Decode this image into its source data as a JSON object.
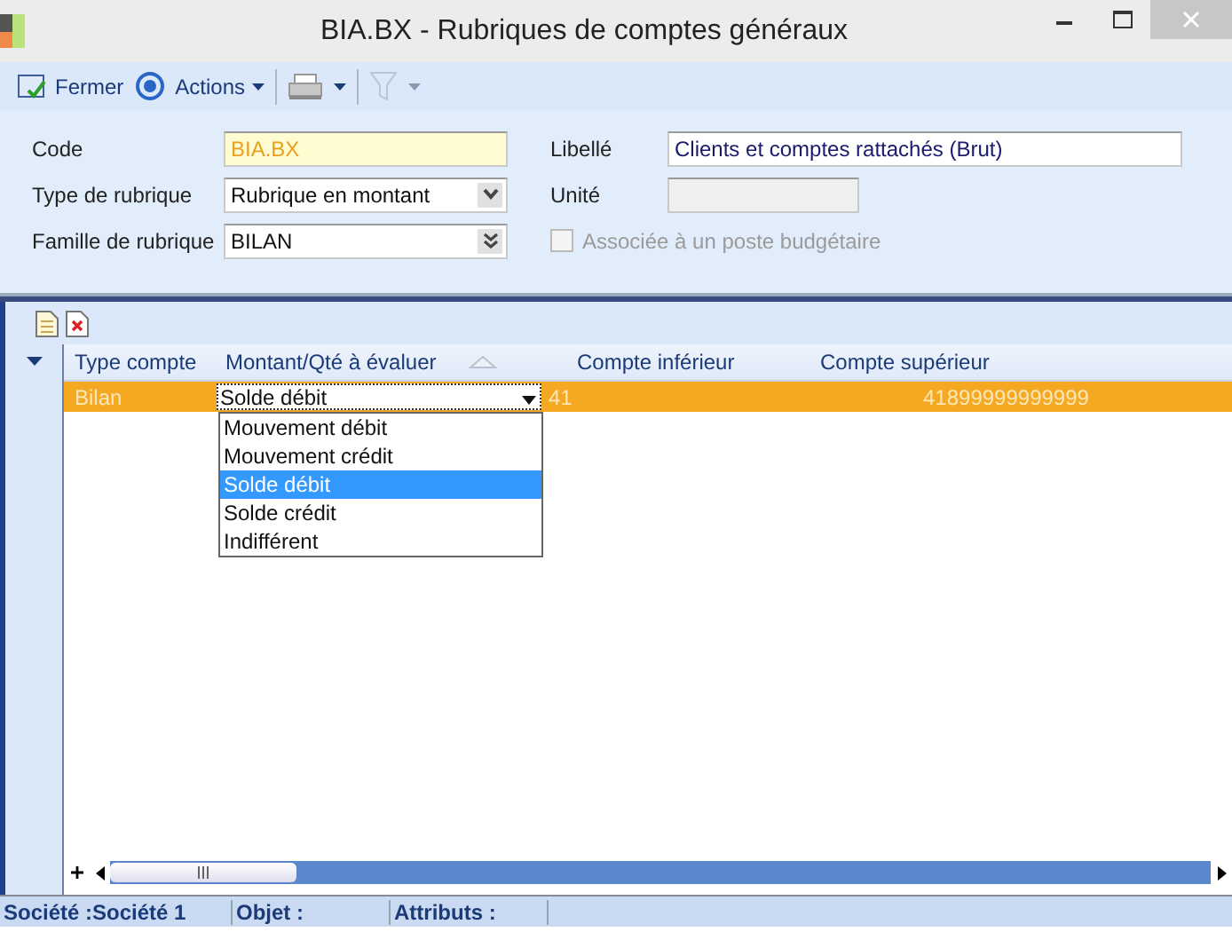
{
  "window": {
    "title": "BIA.BX -  Rubriques de comptes généraux"
  },
  "toolbar": {
    "close_label": "Fermer",
    "actions_label": "Actions",
    "filter_disabled": true
  },
  "form": {
    "left": [
      {
        "label": "Code",
        "value": "BIA.BX",
        "kind": "code"
      },
      {
        "label": "Type de rubrique",
        "value": "Rubrique en montant",
        "kind": "combo"
      },
      {
        "label": "Famille de rubrique",
        "value": "BILAN",
        "kind": "combo2"
      }
    ],
    "right": [
      {
        "label": "Libellé",
        "value": "Clients et comptes rattachés (Brut)",
        "kind": "text"
      },
      {
        "label": "Unité",
        "kind": "disabled"
      }
    ],
    "checkbox": {
      "label": "Associée à un poste budgétaire",
      "checked": false,
      "disabled": true
    }
  },
  "grid": {
    "columns": [
      {
        "label": "Type compte",
        "sorted": false
      },
      {
        "label": "Montant/Qté à évaluer",
        "sorted": true
      },
      {
        "label": "Compte inférieur",
        "sorted": false
      },
      {
        "label": "Compte supérieur",
        "sorted": false
      }
    ],
    "rows": [
      {
        "selected": true,
        "cells": [
          {
            "text": "Bilan"
          },
          {
            "text": "Solde débit",
            "kind": "dropdown",
            "expanded": true,
            "options": [
              {
                "label": "Mouvement débit",
                "selected": false
              },
              {
                "label": "Mouvement crédit",
                "selected": false
              },
              {
                "label": "Solde débit",
                "selected": true
              },
              {
                "label": "Solde crédit",
                "selected": false
              },
              {
                "label": "Indifférent",
                "selected": false
              }
            ]
          },
          {
            "text": "41"
          },
          {
            "text": "41899999999999"
          }
        ]
      }
    ]
  },
  "status_bar": [
    "Société :Société 1",
    "Objet :",
    "Attributs :"
  ]
}
